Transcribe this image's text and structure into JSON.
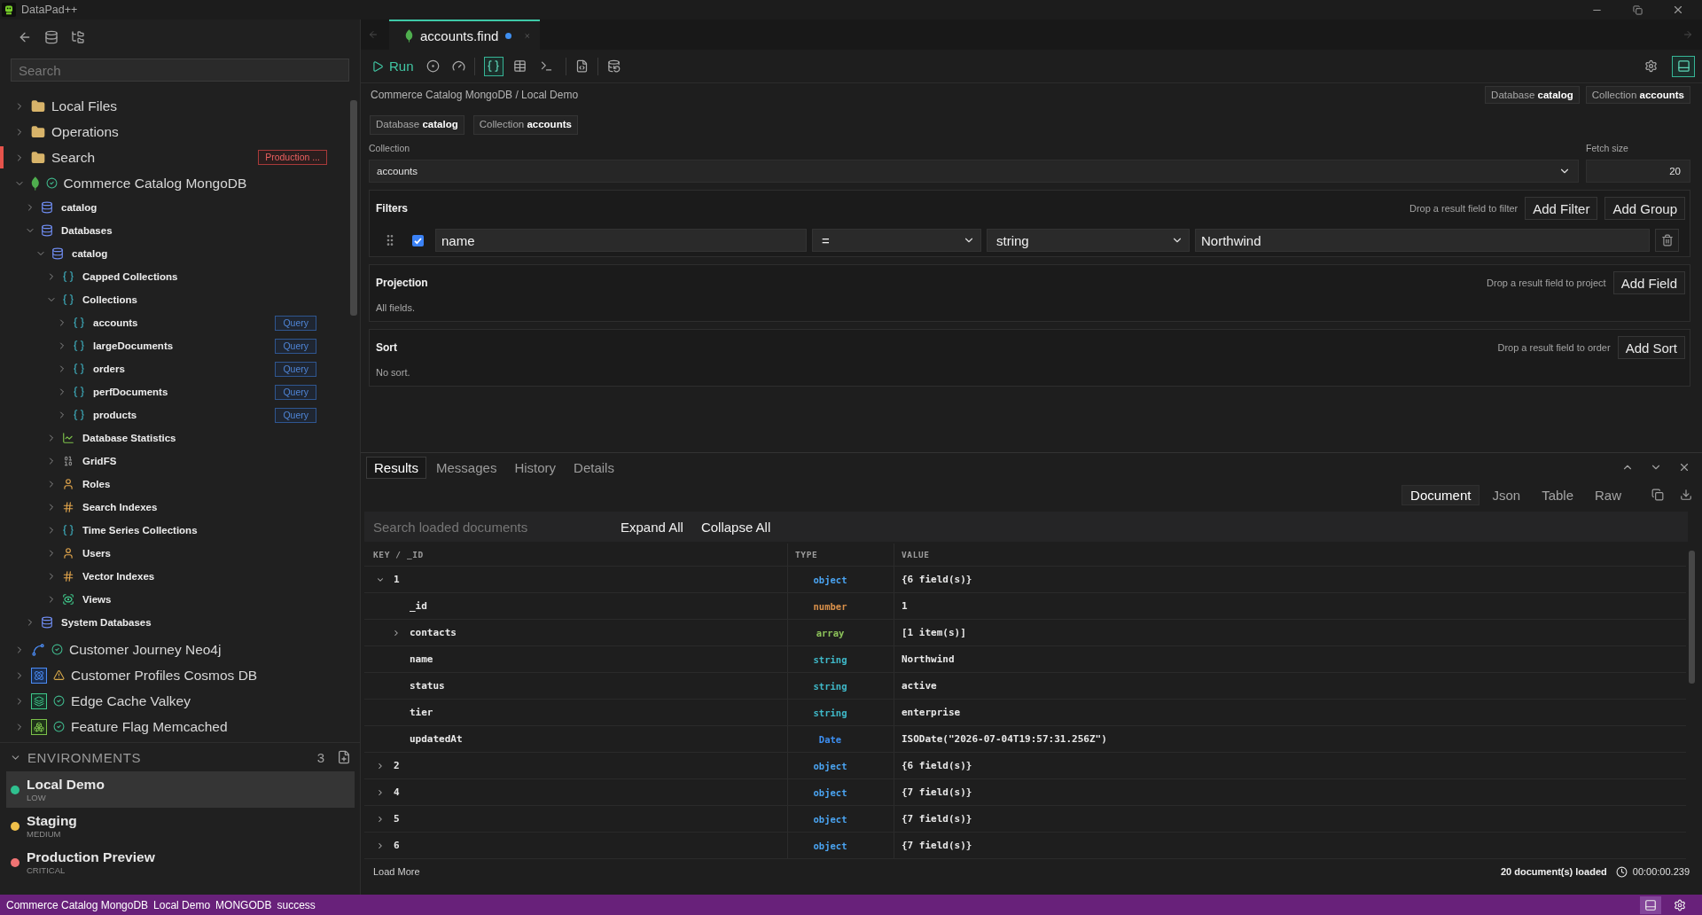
{
  "app": {
    "title": "DataPad++"
  },
  "sidebar": {
    "search": {
      "placeholder": "Search"
    },
    "tree": [
      {
        "label": "Local Files",
        "kind": "folder",
        "expanded": false
      },
      {
        "label": "Operations",
        "kind": "folder",
        "expanded": false
      },
      {
        "label": "Search",
        "kind": "folder",
        "expanded": false,
        "color": "#e5534b",
        "badge": {
          "text": "Production ...",
          "kind": "danger"
        }
      },
      {
        "label": "Commerce Catalog MongoDB",
        "kind": "mongodb",
        "healthy": true,
        "expanded": true,
        "children": [
          {
            "label": "catalog",
            "kind": "database",
            "expanded": false
          },
          {
            "label": "Databases",
            "kind": "database",
            "expanded": true,
            "children": [
              {
                "label": "catalog",
                "kind": "database",
                "expanded": true,
                "children": [
                  {
                    "label": "Capped Collections",
                    "kind": "collections",
                    "expanded": false
                  },
                  {
                    "label": "Collections",
                    "kind": "collections",
                    "expanded": true,
                    "children": [
                      {
                        "label": "accounts",
                        "kind": "collections",
                        "expanded": false,
                        "badge": {
                          "text": "Query",
                          "kind": "info"
                        }
                      },
                      {
                        "label": "largeDocuments",
                        "kind": "collections",
                        "expanded": false,
                        "badge": {
                          "text": "Query",
                          "kind": "info"
                        }
                      },
                      {
                        "label": "orders",
                        "kind": "collections",
                        "expanded": false,
                        "badge": {
                          "text": "Query",
                          "kind": "info"
                        }
                      },
                      {
                        "label": "perfDocuments",
                        "kind": "collections",
                        "expanded": false,
                        "badge": {
                          "text": "Query",
                          "kind": "info"
                        }
                      },
                      {
                        "label": "products",
                        "kind": "collections",
                        "expanded": false,
                        "badge": {
                          "text": "Query",
                          "kind": "info"
                        }
                      }
                    ]
                  },
                  {
                    "label": "Database Statistics",
                    "kind": "stats",
                    "expanded": false
                  },
                  {
                    "label": "GridFS",
                    "kind": "gridfs",
                    "expanded": false
                  },
                  {
                    "label": "Roles",
                    "kind": "user",
                    "expanded": false
                  },
                  {
                    "label": "Search Indexes",
                    "kind": "index",
                    "expanded": false
                  },
                  {
                    "label": "Time Series Collections",
                    "kind": "collections",
                    "expanded": false
                  },
                  {
                    "label": "Users",
                    "kind": "user",
                    "expanded": false
                  },
                  {
                    "label": "Vector Indexes",
                    "kind": "index",
                    "expanded": false
                  },
                  {
                    "label": "Views",
                    "kind": "view",
                    "expanded": false
                  }
                ]
              }
            ]
          },
          {
            "label": "System Databases",
            "kind": "database",
            "expanded": false
          }
        ]
      },
      {
        "label": "Customer Journey Neo4j",
        "kind": "neo4j",
        "healthy": true,
        "expanded": false
      },
      {
        "label": "Customer Profiles Cosmos DB",
        "kind": "cosmos",
        "healthy": false,
        "expanded": false
      },
      {
        "label": "Edge Cache Valkey",
        "kind": "valkey",
        "healthy": true,
        "expanded": false
      },
      {
        "label": "Feature Flag Memcached",
        "kind": "memcached",
        "healthy": true,
        "expanded": false
      }
    ],
    "environments": {
      "title": "ENVIRONMENTS",
      "count": "3",
      "expanded": true,
      "items": [
        {
          "name": "Local Demo",
          "risk": "LOW",
          "color": "#2fc08f",
          "selected": true
        },
        {
          "name": "Staging",
          "risk": "MEDIUM",
          "color": "#f0c04a",
          "selected": false
        },
        {
          "name": "Production Preview",
          "risk": "CRITICAL",
          "color": "#f07474",
          "selected": false
        }
      ]
    }
  },
  "editor_tabs": [
    {
      "title": "accounts.find",
      "modified": true,
      "selected": true
    }
  ],
  "toolbar": {
    "run": "Run",
    "view_modes": [
      {
        "kind": "document",
        "selected": true
      },
      {
        "kind": "table",
        "selected": false
      },
      {
        "kind": "shell",
        "selected": false
      }
    ],
    "layout_toggle": {
      "selected": true
    }
  },
  "context": {
    "path": "Commerce Catalog MongoDB / Local Demo",
    "chips": [
      {
        "label": "Database",
        "value": "catalog"
      },
      {
        "label": "Collection",
        "value": "accounts"
      }
    ]
  },
  "query": {
    "chips": [
      {
        "label": "Database",
        "value": "catalog"
      },
      {
        "label": "Collection",
        "value": "accounts"
      }
    ],
    "collection": {
      "label": "Collection",
      "value": "accounts"
    },
    "fetch_size": {
      "label": "Fetch size",
      "value": "20"
    },
    "filters": {
      "title": "Filters",
      "hint": "Drop a result field to filter",
      "buttons": [
        "Add Filter",
        "Add Group"
      ],
      "rows": [
        {
          "enabled": true,
          "field": "name",
          "operator": "=",
          "type": "string",
          "value": "Northwind"
        }
      ]
    },
    "projection": {
      "title": "Projection",
      "summary": "All fields.",
      "hint": "Drop a result field to project",
      "buttons": [
        "Add Field"
      ]
    },
    "sort": {
      "title": "Sort",
      "summary": "No sort.",
      "hint": "Drop a result field to order",
      "buttons": [
        "Add Sort"
      ]
    }
  },
  "results": {
    "tabs": [
      {
        "label": "Results",
        "selected": true
      },
      {
        "label": "Messages",
        "selected": false
      },
      {
        "label": "History",
        "selected": false
      },
      {
        "label": "Details",
        "selected": false
      }
    ],
    "views": [
      {
        "label": "Document",
        "selected": true
      },
      {
        "label": "Json",
        "selected": false
      },
      {
        "label": "Table",
        "selected": false
      },
      {
        "label": "Raw",
        "selected": false
      }
    ],
    "search": {
      "placeholder": "Search loaded documents"
    },
    "actions": [
      "Expand All",
      "Collapse All"
    ],
    "columns": [
      "KEY / _ID",
      "TYPE",
      "VALUE"
    ],
    "rows": [
      {
        "key": "1",
        "type": "object",
        "color": "#4aa3f0",
        "value": "{6 field(s)}",
        "expanded": true,
        "children": [
          {
            "key": "_id",
            "type": "number",
            "color": "#d9904a",
            "value": "1"
          },
          {
            "key": "contacts",
            "type": "array",
            "color": "#8cc25a",
            "value": "[1 item(s)]",
            "expanded": false
          },
          {
            "key": "name",
            "type": "string",
            "color": "#3fb9c9",
            "value": "Northwind"
          },
          {
            "key": "status",
            "type": "string",
            "color": "#3fb9c9",
            "value": "active"
          },
          {
            "key": "tier",
            "type": "string",
            "color": "#3fb9c9",
            "value": "enterprise"
          },
          {
            "key": "updatedAt",
            "type": "Date",
            "color": "#3d8ef0",
            "value": "ISODate(\"2026-07-04T19:57:31.256Z\")"
          }
        ]
      },
      {
        "key": "2",
        "type": "object",
        "color": "#4aa3f0",
        "value": "{6 field(s)}",
        "expanded": false
      },
      {
        "key": "4",
        "type": "object",
        "color": "#4aa3f0",
        "value": "{7 field(s)}",
        "expanded": false
      },
      {
        "key": "5",
        "type": "object",
        "color": "#4aa3f0",
        "value": "{7 field(s)}",
        "expanded": false
      },
      {
        "key": "6",
        "type": "object",
        "color": "#4aa3f0",
        "value": "{7 field(s)}",
        "expanded": false
      }
    ],
    "load_more": "Load More",
    "count": "20 document(s) loaded",
    "elapsed": "00:00:00.239"
  },
  "status_bar": {
    "items": [
      "Commerce Catalog MongoDB",
      "Local Demo",
      "MONGODB",
      "success"
    ],
    "panel_toggle": {
      "selected": true
    }
  }
}
